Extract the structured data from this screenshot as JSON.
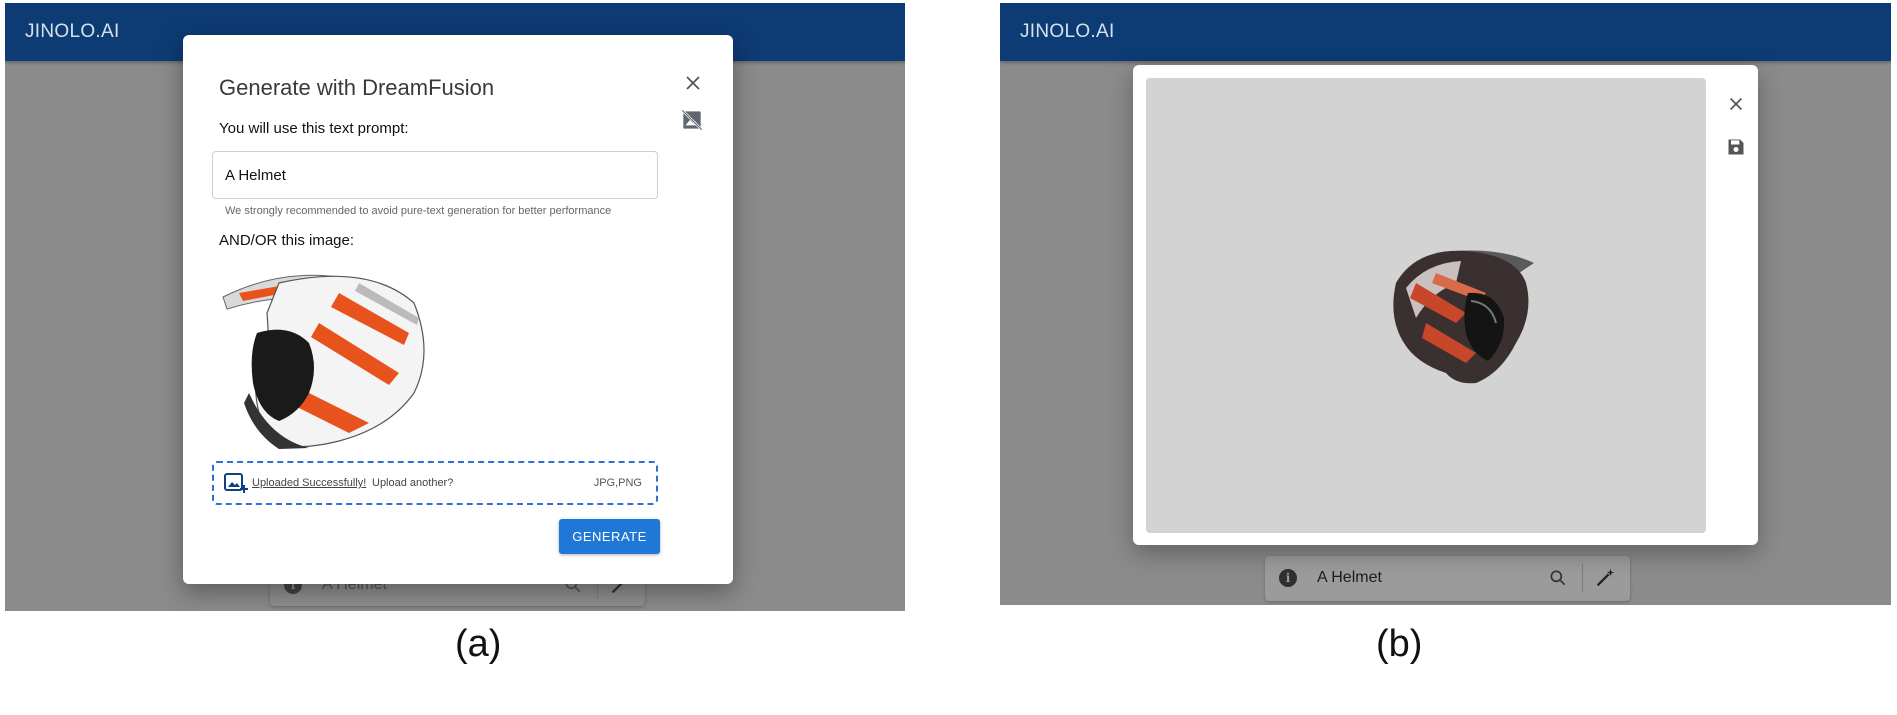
{
  "panel_a": {
    "brand": "JINOLO.AI",
    "dialog": {
      "title": "Generate with DreamFusion",
      "close_icon": "close-icon",
      "hide_image_icon": "hide-image-icon",
      "prompt_label": "You will use this text prompt:",
      "prompt_value": "A Helmet",
      "prompt_helper": "We strongly recommended to avoid pure-text generation for better performance",
      "image_label": "AND/OR this image:",
      "upload": {
        "success_text": "Uploaded Successfully!",
        "another_text": "Upload another?",
        "formats": "JPG,PNG",
        "icon": "add-photo-icon"
      },
      "generate_label": "GENERATE"
    },
    "searchbar": {
      "text": "A Helmet",
      "info_icon": "info-icon",
      "search_icon": "search-icon",
      "wand_icon": "magic-wand-icon"
    }
  },
  "panel_b": {
    "brand": "JINOLO.AI",
    "viewer": {
      "close_icon": "close-icon",
      "save_icon": "save-icon"
    },
    "searchbar": {
      "text": "A Helmet",
      "info_icon": "info-icon",
      "search_icon": "search-icon",
      "wand_icon": "magic-wand-icon"
    }
  },
  "captions": {
    "a": "(a)",
    "b": "(b)"
  },
  "colors": {
    "appbar": "#0d3b73",
    "primary": "#1f78d6",
    "overlay": "#8b8b8b",
    "helmet_accent": "#e8521c"
  }
}
